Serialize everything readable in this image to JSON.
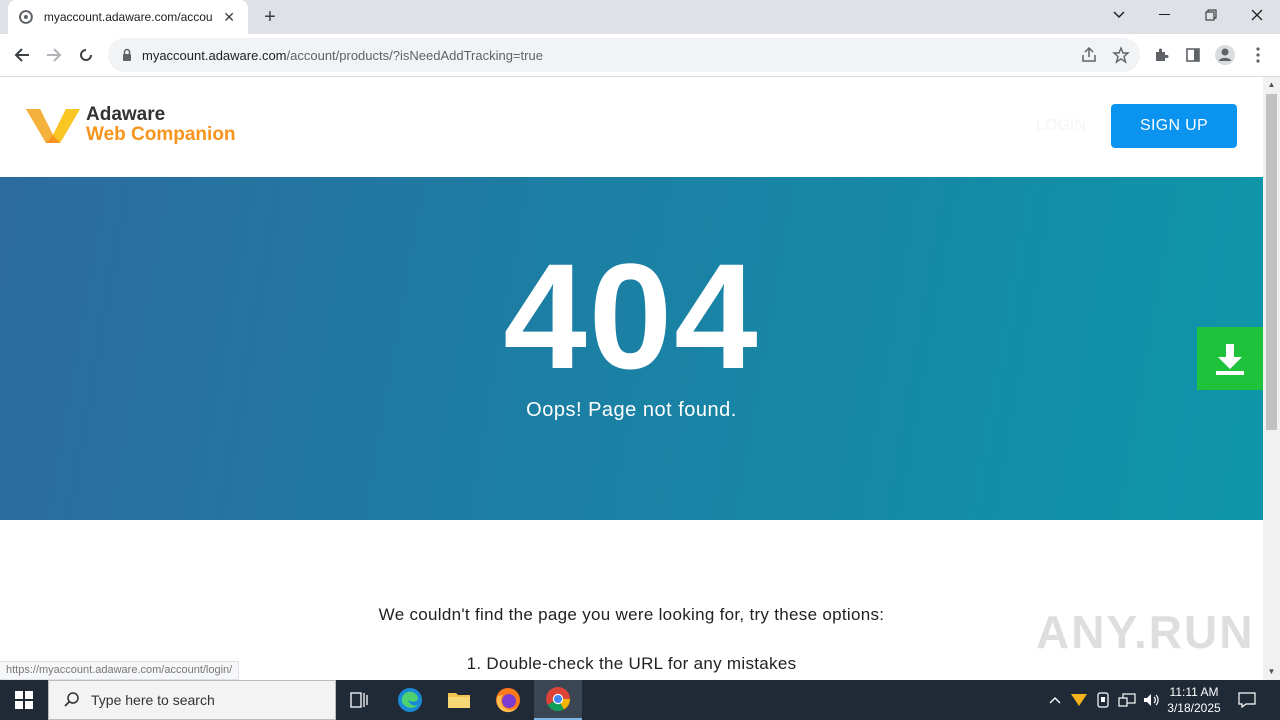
{
  "browser": {
    "tab": {
      "title": "myaccount.adaware.com/accou"
    },
    "url_host": "myaccount.adaware.com",
    "url_path": "/account/products/?isNeedAddTracking=true"
  },
  "header": {
    "logo_line1": "Adaware",
    "logo_line2": "Web Companion",
    "login_label": "LOGIN",
    "signup_label": "SIGN UP"
  },
  "hero": {
    "code": "404",
    "message": "Oops! Page not found."
  },
  "content": {
    "intro": "We couldn't find the page you were looking for, try these options:",
    "option1": "1. Double-check the URL for any mistakes"
  },
  "status_bar": {
    "url": "https://myaccount.adaware.com/account/login/"
  },
  "watermark": "ANY.RUN",
  "taskbar": {
    "search_placeholder": "Type here to search",
    "time": "11:11 AM",
    "date": "3/18/2025"
  },
  "colors": {
    "accent_blue": "#0a93ef",
    "brand_orange": "#f7941d",
    "download_green": "#1fc33b"
  }
}
